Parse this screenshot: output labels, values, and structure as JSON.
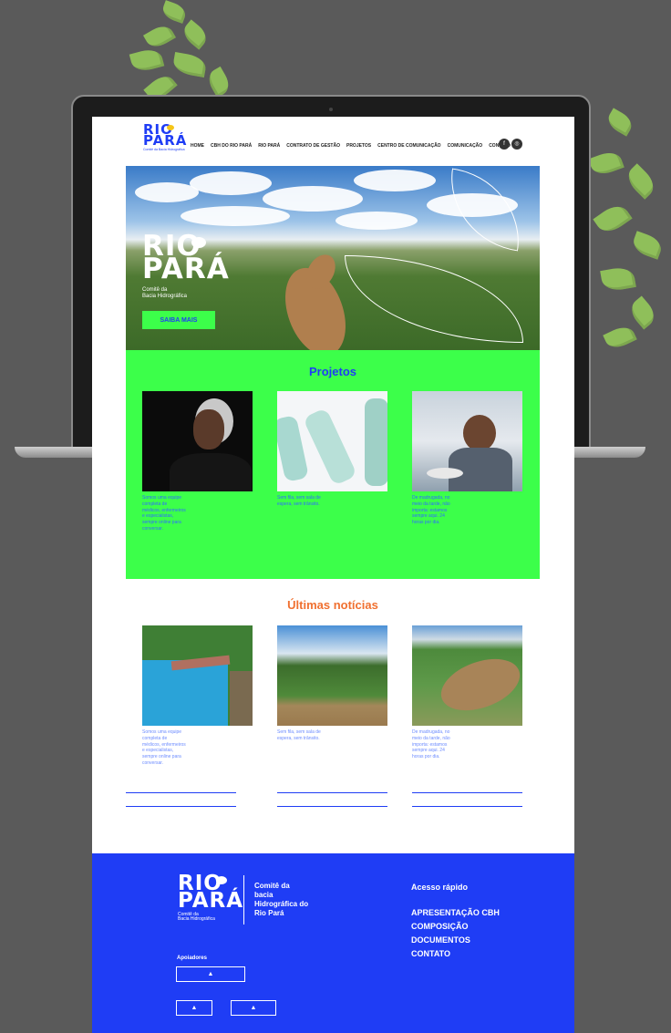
{
  "brand": {
    "logo_line1": "RIO",
    "logo_line2": "PARÁ",
    "logo_sub": "Comitê da Bacia Hidrográfica"
  },
  "nav": {
    "items": [
      "HOME",
      "CBH DO RIO PARÁ",
      "RIO PARÁ",
      "CONTRATO DE GESTÃO",
      "PROJETOS",
      "CENTRO DE COMUNICAÇÃO",
      "COMUNICAÇÃO",
      "CONTATO"
    ]
  },
  "social": {
    "facebook_icon": "f",
    "instagram_icon": "◎"
  },
  "hero": {
    "logo_sub_line1": "Comitê da",
    "logo_sub_line2": "Bacia Hidrográfica",
    "button_label": "SAIBA MAIS"
  },
  "projetos": {
    "title": "Projetos",
    "cards": [
      {
        "text": "Somos uma equipe completa de médicos, enfermeiros e especialistas, sempre online para conversar."
      },
      {
        "text": "Sem fila, sem sala de espera, sem trânsito."
      },
      {
        "text": "De madrugada, no meio da tarde, não importa: estamos sempre aqui. 24 horas por dia."
      }
    ]
  },
  "noticias": {
    "title": "Últimas notícias",
    "cards": [
      {
        "text": "Somos uma equipe completa de médicos, enfermeiros e especialistas, sempre online para conversar."
      },
      {
        "text": "Sem fila, sem sala de espera, sem trânsito."
      },
      {
        "text": "De madrugada, no meio da tarde, não importa: estamos sempre aqui. 24 horas por dia."
      }
    ]
  },
  "footer": {
    "logo_sub_line1": "Comitê da",
    "logo_sub_line2": "Bacia Hidrográfica",
    "desc": "Comitê da bacia Hidrográfica do Rio Pará",
    "acesso_title": "Acesso rápido",
    "links": [
      "APRESENTAÇÃO CBH",
      "COMPOSIÇÃO",
      "DOCUMENTOS",
      "CONTATO"
    ],
    "apoiadores_label": "Apoiadores",
    "sponsor_icon": "image-icon"
  },
  "colors": {
    "brand_blue": "#1f3df5",
    "brand_green": "#3cff4a",
    "accent_orange": "#f07030",
    "accent_yellow": "#f5c518"
  }
}
